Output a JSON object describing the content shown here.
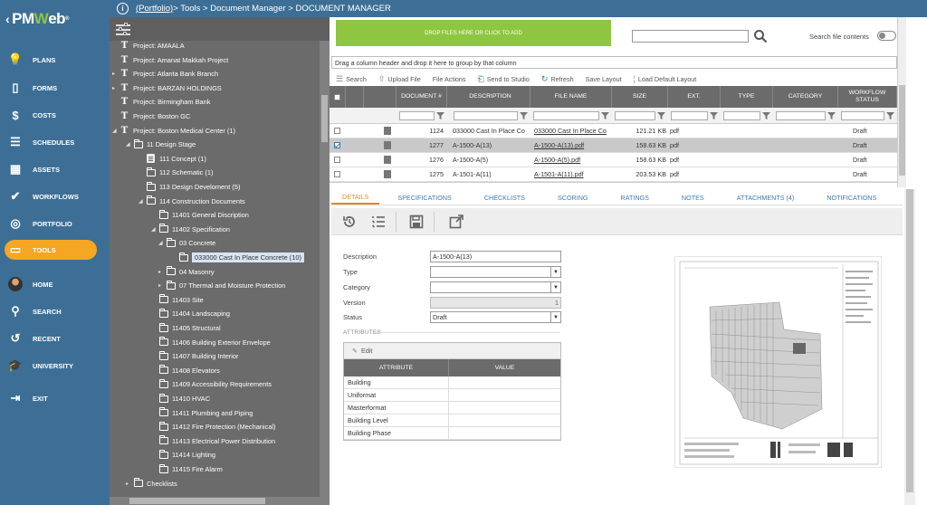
{
  "app": {
    "logo": {
      "chevron": "‹",
      "pre": "PM",
      "accent": "W",
      "post": "eb",
      "mark": "®"
    },
    "breadcrumb": {
      "root": "(Portfolio)",
      "rest": " > Tools > Document Manager > DOCUMENT MANAGER"
    }
  },
  "nav": [
    {
      "label": "PLANS",
      "icon": "bulb-icon",
      "glyph": "💡"
    },
    {
      "label": "FORMS",
      "icon": "forms-icon",
      "glyph": "▯"
    },
    {
      "label": "COSTS",
      "icon": "dollar-icon",
      "glyph": "$"
    },
    {
      "label": "SCHEDULES",
      "icon": "schedule-icon",
      "glyph": "☰"
    },
    {
      "label": "ASSETS",
      "icon": "assets-icon",
      "glyph": "▦"
    },
    {
      "label": "WORKFLOWS",
      "icon": "check-icon",
      "glyph": "✔"
    },
    {
      "label": "PORTFOLIO",
      "icon": "globe-icon",
      "glyph": "◎"
    },
    {
      "label": "TOOLS",
      "icon": "toolbox-icon",
      "glyph": "▭"
    },
    {
      "label": "HOME",
      "icon": "avatar-icon",
      "glyph": ""
    },
    {
      "label": "SEARCH",
      "icon": "search-icon",
      "glyph": "⚲"
    },
    {
      "label": "RECENT",
      "icon": "recent-icon",
      "glyph": "↺"
    },
    {
      "label": "UNIVERSITY",
      "icon": "graduation-cap-icon",
      "glyph": "🎓"
    },
    {
      "label": "EXIT",
      "icon": "exit-icon",
      "glyph": "⇥"
    }
  ],
  "tree": [
    {
      "label": "Project: AMAALA",
      "type": "project",
      "tog": ""
    },
    {
      "label": "Project: Amanat Makkah Project",
      "type": "project",
      "tog": ""
    },
    {
      "label": "Project: Atlanta Bank Branch",
      "type": "project",
      "tog": "▸"
    },
    {
      "label": "Project: BARZAN HOLDINGS",
      "type": "project",
      "tog": "▸"
    },
    {
      "label": "Project: Birmingham Bank",
      "type": "project",
      "tog": ""
    },
    {
      "label": "Project: Boston GC",
      "type": "project",
      "tog": ""
    },
    {
      "label": "Project: Boston Medical Center (1)",
      "type": "project",
      "tog": "◢"
    },
    {
      "label": "11 Design Stage",
      "type": "folder",
      "tog": "◢"
    },
    {
      "label": "111 Concept (1)",
      "type": "doc",
      "tog": ""
    },
    {
      "label": "112 Schematic (1)",
      "type": "folder",
      "tog": ""
    },
    {
      "label": "113 Design Develoment (5)",
      "type": "folder",
      "tog": ""
    },
    {
      "label": "114 Construction Documents",
      "type": "folder",
      "tog": "◢"
    },
    {
      "label": "11401 General Discription",
      "type": "folder",
      "tog": ""
    },
    {
      "label": "11402 Specification",
      "type": "folder",
      "tog": "◢"
    },
    {
      "label": "03 Concrete",
      "type": "folder",
      "tog": "◢"
    },
    {
      "label": "033000 Cast In Place Concrete (10)",
      "type": "folder",
      "tog": "",
      "selected": true
    },
    {
      "label": "04 Masonry",
      "type": "folder",
      "tog": "▸"
    },
    {
      "label": "07 Thermal and Moisture Protection",
      "type": "folder",
      "tog": "▸"
    },
    {
      "label": "11403 Site",
      "type": "folder",
      "tog": ""
    },
    {
      "label": "11404 Landscaping",
      "type": "folder",
      "tog": ""
    },
    {
      "label": "11405 Structural",
      "type": "folder",
      "tog": ""
    },
    {
      "label": "11406 Building Exterior Envelope",
      "type": "folder",
      "tog": ""
    },
    {
      "label": "11407 Building Interior",
      "type": "folder",
      "tog": ""
    },
    {
      "label": "11408 Elevators",
      "type": "folder",
      "tog": ""
    },
    {
      "label": "11409 Accessibility Requirements",
      "type": "folder",
      "tog": ""
    },
    {
      "label": "11410 HVAC",
      "type": "folder",
      "tog": ""
    },
    {
      "label": "11411 Plumbing and Piping",
      "type": "folder",
      "tog": ""
    },
    {
      "label": "11412 Fire Protection (Mechanical)",
      "type": "folder",
      "tog": ""
    },
    {
      "label": "11413 Electrical Power Distribution",
      "type": "folder",
      "tog": ""
    },
    {
      "label": "11414 Lighting",
      "type": "folder",
      "tog": ""
    },
    {
      "label": "11415 Fire Alarm",
      "type": "folder",
      "tog": ""
    },
    {
      "label": "Checklists",
      "type": "folder",
      "tog": "▸"
    }
  ],
  "upload": {
    "drop_label": "DROP FILES HERE OR CLICK TO ADD",
    "search_placeholder": "",
    "search_contents_label": "Search file contents"
  },
  "grid": {
    "group_hint": "Drag a column header and drop it here to group by that column",
    "toolbar": [
      {
        "label": "Search",
        "glyph": "☰"
      },
      {
        "label": "Upload File",
        "glyph": "⇧"
      },
      {
        "label": "File Actions",
        "glyph": ""
      },
      {
        "label": "Send to Studio",
        "glyph": "⎗"
      },
      {
        "label": "Refresh",
        "glyph": "↻"
      },
      {
        "label": "Save Layout",
        "glyph": ""
      },
      {
        "label": "Load Default Layout",
        "glyph": "¦"
      }
    ],
    "columns": [
      "DOCUMENT #",
      "DESCRIPTION",
      "FILE NAME",
      "SIZE",
      "EXT.",
      "TYPE",
      "CATEGORY",
      "WORKFLOW STATUS"
    ],
    "rows": [
      {
        "num": "1124",
        "desc": "033000 Cast In Place Co",
        "file": "033000 Cast In Place Co",
        "size": "121.21 KB",
        "ext": "pdf",
        "type": "",
        "category": "",
        "status": "Draft",
        "checked": false,
        "selected": false
      },
      {
        "num": "1277",
        "desc": "A-1500-A(13)",
        "file": "A-1500-A(13).pdf",
        "size": "158.63 KB",
        "ext": "pdf",
        "type": "",
        "category": "",
        "status": "Draft",
        "checked": true,
        "selected": true
      },
      {
        "num": "1276",
        "desc": "A-1500-A(5)",
        "file": "A-1500-A(5).pdf",
        "size": "158.63 KB",
        "ext": "pdf",
        "type": "",
        "category": "",
        "status": "Draft",
        "checked": false,
        "selected": false
      },
      {
        "num": "1275",
        "desc": "A-1501-A(11)",
        "file": "A-1501-A(11).pdf",
        "size": "203.53 KB",
        "ext": "pdf",
        "type": "",
        "category": "",
        "status": "Draft",
        "checked": false,
        "selected": false
      },
      {
        "num": "1274",
        "desc": "A-1501-A(12)",
        "file": "A-1501-A(12).pdf",
        "size": "203.53 KB",
        "ext": "pdf",
        "type": "",
        "category": "",
        "status": "Draft",
        "checked": false,
        "selected": false
      }
    ]
  },
  "tabs": [
    "DETAILS",
    "SPECIFICATIONS",
    "CHECKLISTS",
    "SCORING",
    "RATINGS",
    "NOTES",
    "ATTACHMENTS (4)",
    "NOTIFICATIONS"
  ],
  "details": {
    "fields": [
      {
        "label": "Description",
        "value": "A-1500-A(13)",
        "dropdown": false,
        "disabled": false
      },
      {
        "label": "Type",
        "value": "",
        "dropdown": true,
        "disabled": false
      },
      {
        "label": "Category",
        "value": "",
        "dropdown": true,
        "disabled": false
      },
      {
        "label": "Version",
        "value": "1",
        "dropdown": false,
        "disabled": true
      },
      {
        "label": "Status",
        "value": "Draft",
        "dropdown": true,
        "disabled": false
      }
    ],
    "attributes_title": "ATTRIBUTES",
    "edit_label": "Edit",
    "attr_columns": [
      "ATTRIBUTE",
      "VALUE"
    ],
    "attributes": [
      "Building",
      "Uniformat",
      "Masterformat",
      "Building Level",
      "Building Phase"
    ]
  },
  "colors": {
    "nav_bg": "#3d6f96",
    "accent_orange": "#f5a623",
    "drop_green": "#8ec641",
    "tree_bg": "#6b6b6b",
    "tab_active": "#e08a1e",
    "link_blue": "#3d7ab5"
  }
}
